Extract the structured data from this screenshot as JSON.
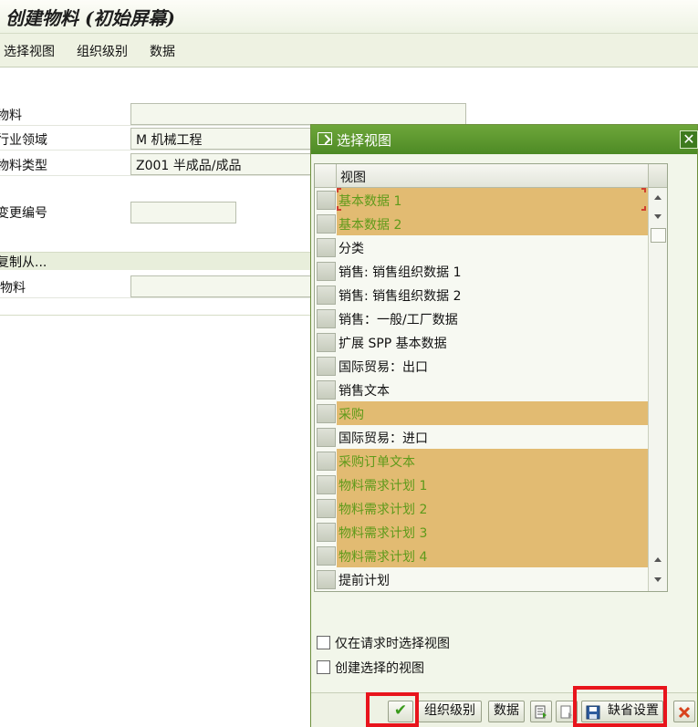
{
  "window": {
    "title": "创建物料 (初始屏幕)",
    "menu": [
      "选择视图",
      "组织级别",
      "数据"
    ]
  },
  "form": {
    "material_label": "物料",
    "material_value": "",
    "industry_label": "行业领域",
    "industry_value": "M 机械工程",
    "type_label": "物料类型",
    "type_value": "Z001 半成品/成品",
    "change_no_label": "变更编号",
    "change_no_value": "",
    "copy_section": "复制从...",
    "copy_material_label": "物料",
    "copy_material_value": ""
  },
  "dialog": {
    "title": "选择视图",
    "column_header": "视图",
    "rows": [
      {
        "label": "基本数据 1",
        "selected": true
      },
      {
        "label": "基本数据 2",
        "selected": true
      },
      {
        "label": "分类",
        "selected": false
      },
      {
        "label": "销售: 销售组织数据 1",
        "selected": false
      },
      {
        "label": "销售: 销售组织数据 2",
        "selected": false
      },
      {
        "label": "销售：一般/工厂数据",
        "selected": false
      },
      {
        "label": "扩展 SPP 基本数据",
        "selected": false
      },
      {
        "label": "国际贸易：出口",
        "selected": false
      },
      {
        "label": "销售文本",
        "selected": false
      },
      {
        "label": "采购",
        "selected": true
      },
      {
        "label": "国际贸易：进口",
        "selected": false
      },
      {
        "label": "采购订单文本",
        "selected": true
      },
      {
        "label": "物料需求计划 1",
        "selected": true
      },
      {
        "label": "物料需求计划 2",
        "selected": true
      },
      {
        "label": "物料需求计划 3",
        "selected": true
      },
      {
        "label": "物料需求计划 4",
        "selected": true
      },
      {
        "label": "提前计划",
        "selected": false
      }
    ],
    "checkbox_only_on_request": "仅在请求时选择视图",
    "checkbox_create_selected": "创建选择的视图",
    "buttons": {
      "org_levels": "组织级别",
      "data": "数据",
      "default": "缺省设置"
    }
  },
  "colors": {
    "selected_row_bg": "#e2bb72",
    "selected_row_text": "#5e9a1a",
    "dialog_title_bg": "#5b9630",
    "highlight_box": "#e8141c"
  }
}
